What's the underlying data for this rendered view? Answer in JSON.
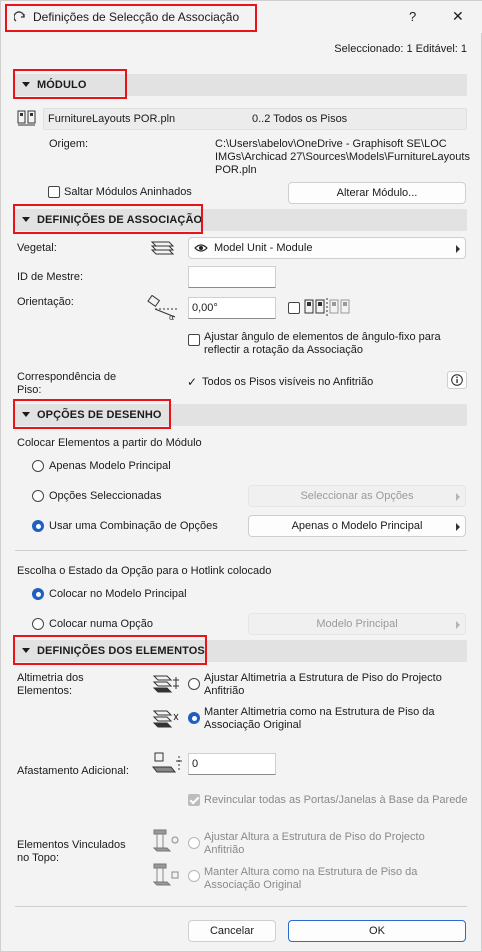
{
  "window": {
    "title": "Definições de Selecção de Associação",
    "help_label": "?",
    "close_label": "✕",
    "selection_status": "Seleccionado: 1 Editável: 1"
  },
  "modulo": {
    "header": "MÓDULO",
    "file_name": "FurnitureLayouts POR.pln",
    "floors": "0..2 Todos os Pisos",
    "origin_label": "Origem:",
    "origin_path_1": "C:\\Users\\abelov\\OneDrive - Graphisoft SE\\LOC",
    "origin_path_2": "IMGs\\Archicad 27\\Sources\\Models\\FurnitureLayouts",
    "origin_path_3": "POR.pln",
    "skip_nested_label": "Saltar Módulos Aninhados",
    "skip_nested_checked": false,
    "change_module_button": "Alterar Módulo..."
  },
  "associacao": {
    "header": "DEFINIÇÕES DE ASSOCIAÇÃO",
    "layer_label": "Vegetal:",
    "layer_value": "Model Unit - Module",
    "master_id_label": "ID de Mestre:",
    "master_id_value": "",
    "orientation_label": "Orientação:",
    "orientation_value": "0,00°",
    "mirror_checked": false,
    "adjust_angle_label_1": "Ajustar ângulo de elementos de ângulo-fixo para",
    "adjust_angle_label_2": "reflectir a rotação da Associação",
    "adjust_angle_checked": false,
    "floor_match_label_1": "Correspondência de",
    "floor_match_label_2": "Piso:",
    "floor_match_value": "Todos os Pisos visíveis no Anfitrião",
    "info_icon": "info-icon"
  },
  "desenho": {
    "header": "OPÇÕES DE DESENHO",
    "place_from_label": "Colocar Elementos a partir do Módulo",
    "options": [
      {
        "label": "Apenas Modelo Principal",
        "selected": false
      },
      {
        "label": "Opções Seleccionadas",
        "selected": false
      },
      {
        "label": "Usar uma Combinação de Opções",
        "selected": true
      }
    ],
    "select_options_button": "Seleccionar as Opções",
    "combination_value": "Apenas o Modelo Principal",
    "option_state_label": "Escolha o Estado da Opção para o Hotlink colocado",
    "place_options": [
      {
        "label": "Colocar no Modelo Principal",
        "selected": true
      },
      {
        "label": "Colocar numa Opção",
        "selected": false
      }
    ],
    "option_dropdown_value": "Modelo Principal"
  },
  "elementos": {
    "header": "DEFINIÇÕES DOS ELEMENTOS",
    "elevation_label_1": "Altimetria dos",
    "elevation_label_2": "Elementos:",
    "elevation_options": [
      {
        "label_1": "Ajustar Altimetria a Estrutura de Piso do Projecto",
        "label_2": "Anfitrião",
        "selected": false
      },
      {
        "label_1": "Manter Altimetria como na Estrutura de Piso da",
        "label_2": "Associação Original",
        "selected": true
      }
    ],
    "offset_label": "Afastamento Adicional:",
    "offset_value": "0",
    "relink_label": "Revincular todas as Portas/Janelas à Base da Parede",
    "relink_checked": true,
    "top_linked_label_1": "Elementos Vinculados",
    "top_linked_label_2": "no Topo:",
    "top_options": [
      {
        "label_1": "Ajustar Altura a Estrutura de Piso do Projecto",
        "label_2": "Anfitrião",
        "selected": false
      },
      {
        "label_1": "Manter Altura como na Estrutura de Piso da",
        "label_2": "Associação Original",
        "selected": false
      }
    ]
  },
  "footer": {
    "cancel_button": "Cancelar",
    "ok_button": "OK"
  },
  "colors": {
    "highlight_box": "#e8131b",
    "accent": "#1f5fbf",
    "section_bg": "#e2e2e2",
    "window_bg": "#f3f3f3"
  }
}
